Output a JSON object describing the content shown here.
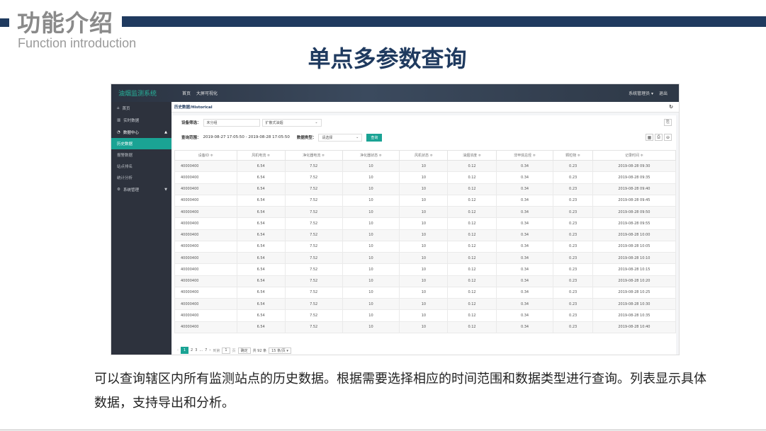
{
  "slide": {
    "heading_cn": "功能介绍",
    "heading_en": "Function introduction",
    "title": "单点多参数查询",
    "caption": "可以查询辖区内所有监测站点的历史数据。根据需要选择相应的时间范围和数据类型进行查询。列表显示具体数据，支持导出和分析。",
    "accent_color": "#1f3a5f"
  },
  "app": {
    "brand": "油烟监测系统",
    "nav": [
      "首页",
      "大屏可视化"
    ],
    "user_menu": "系统管理员 ▾",
    "logout": "退出",
    "sidebar": {
      "home": "首页",
      "realtime": "实时数据",
      "data_center": "数据中心",
      "sub": [
        "历史数据",
        "报警数据",
        "站点排名",
        "统计分析"
      ],
      "system": "系统管理"
    },
    "breadcrumb": "历史数据/Historical",
    "filters": {
      "device_label": "设备筛选：",
      "device_value": "未分组",
      "device2_value": "扩散式油烟",
      "range_label": "查询范围：",
      "range_value": "2019-08-27 17:05:50 - 2019-08-28 17:05:50",
      "type_label": "数据类型：",
      "type_value": "请选择",
      "query_button": "查询"
    },
    "columns": [
      "设备ID ≑",
      "风机电流 ≑",
      "净化器电流 ≑",
      "净化器状态 ≑",
      "风机状态 ≑",
      "油烟浓度 ≑",
      "非甲烷总烃 ≑",
      "颗粒物 ≑",
      "记录时间 ≑"
    ],
    "rows": [
      [
        "40000400",
        "6.54",
        "7.52",
        "10",
        "10",
        "0.12",
        "0.34",
        "0.23",
        "2019-08-28 09:30"
      ],
      [
        "40000400",
        "6.54",
        "7.52",
        "10",
        "10",
        "0.12",
        "0.34",
        "0.23",
        "2019-08-28 09:35"
      ],
      [
        "40000400",
        "6.54",
        "7.52",
        "10",
        "10",
        "0.12",
        "0.34",
        "0.23",
        "2019-08-28 09:40"
      ],
      [
        "40000400",
        "6.54",
        "7.52",
        "10",
        "10",
        "0.12",
        "0.34",
        "0.23",
        "2019-08-28 09:45"
      ],
      [
        "40000400",
        "6.54",
        "7.52",
        "10",
        "10",
        "0.12",
        "0.34",
        "0.23",
        "2019-08-28 09:50"
      ],
      [
        "40000400",
        "6.54",
        "7.52",
        "10",
        "10",
        "0.12",
        "0.34",
        "0.23",
        "2019-08-28 09:55"
      ],
      [
        "40000400",
        "6.54",
        "7.52",
        "10",
        "10",
        "0.12",
        "0.34",
        "0.23",
        "2019-08-28 10:00"
      ],
      [
        "40000400",
        "6.54",
        "7.52",
        "10",
        "10",
        "0.12",
        "0.34",
        "0.23",
        "2019-08-28 10:05"
      ],
      [
        "40000400",
        "6.54",
        "7.52",
        "10",
        "10",
        "0.12",
        "0.34",
        "0.23",
        "2019-08-28 10:10"
      ],
      [
        "40000400",
        "6.54",
        "7.52",
        "10",
        "10",
        "0.12",
        "0.34",
        "0.23",
        "2019-08-28 10:15"
      ],
      [
        "40000400",
        "6.54",
        "7.52",
        "10",
        "10",
        "0.12",
        "0.34",
        "0.23",
        "2019-08-28 10:20"
      ],
      [
        "40000400",
        "6.54",
        "7.52",
        "10",
        "10",
        "0.12",
        "0.34",
        "0.23",
        "2019-08-28 10:25"
      ],
      [
        "40000400",
        "6.54",
        "7.52",
        "10",
        "10",
        "0.12",
        "0.34",
        "0.23",
        "2019-08-28 10:30"
      ],
      [
        "40000400",
        "6.54",
        "7.52",
        "10",
        "10",
        "0.12",
        "0.34",
        "0.23",
        "2019-08-28 10:35"
      ],
      [
        "40000400",
        "6.54",
        "7.52",
        "10",
        "10",
        "0.12",
        "0.34",
        "0.23",
        "2019-08-28 10:40"
      ]
    ],
    "pagination": {
      "prev": "‹",
      "pages": [
        "1",
        "2",
        "3",
        "...",
        "7"
      ],
      "next": "›",
      "goto_label": "到第",
      "goto_value": "1",
      "page_unit": "页",
      "confirm": "确定",
      "total": "共 92 条",
      "per_page": "15 条/页 ▾"
    }
  }
}
